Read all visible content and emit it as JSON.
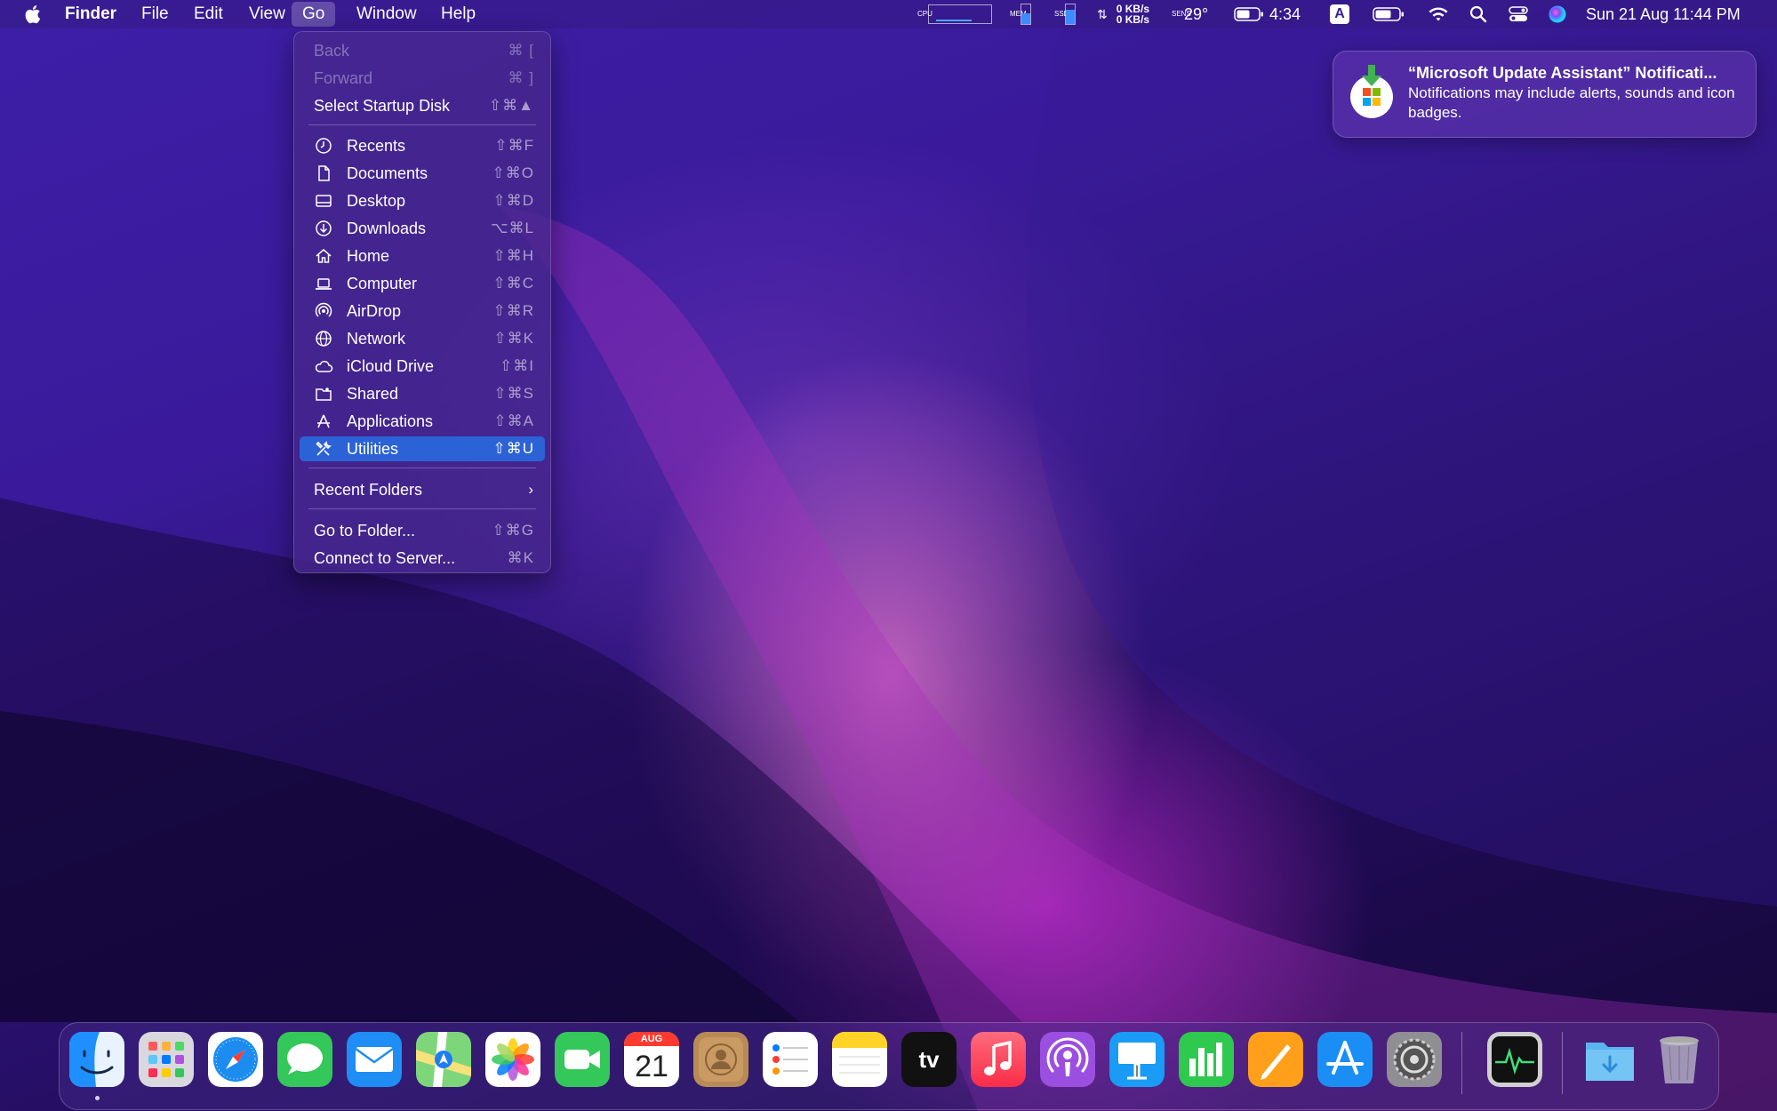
{
  "menubar": {
    "apple": "apple-logo-icon",
    "app_name": "Finder",
    "menus": [
      "File",
      "Edit",
      "View",
      "Go",
      "Window",
      "Help"
    ],
    "active_menu": "Go",
    "status": {
      "cpu_label": "CPU",
      "mem_label": "MEM",
      "ssd_label": "SSD",
      "net_up": "0 KB/s",
      "net_down": "0 KB/s",
      "sens_label": "SENS",
      "temperature": "29°",
      "battery_time": "4:34",
      "input_source": "A",
      "datetime": "Sun 21 Aug  11:44 PM"
    }
  },
  "go_menu": {
    "items": [
      {
        "label": "Back",
        "shortcut": "⌘ [",
        "disabled": true
      },
      {
        "label": "Forward",
        "shortcut": "⌘ ]",
        "disabled": true
      },
      {
        "label": "Select Startup Disk",
        "shortcut": "⇧⌘▲"
      },
      {
        "label": "Recents",
        "shortcut": "⇧⌘F",
        "icon": "clock-icon"
      },
      {
        "label": "Documents",
        "shortcut": "⇧⌘O",
        "icon": "document-icon"
      },
      {
        "label": "Desktop",
        "shortcut": "⇧⌘D",
        "icon": "desktop-icon"
      },
      {
        "label": "Downloads",
        "shortcut": "⌥⌘L",
        "icon": "download-icon"
      },
      {
        "label": "Home",
        "shortcut": "⇧⌘H",
        "icon": "home-icon"
      },
      {
        "label": "Computer",
        "shortcut": "⇧⌘C",
        "icon": "laptop-icon"
      },
      {
        "label": "AirDrop",
        "shortcut": "⇧⌘R",
        "icon": "airdrop-icon"
      },
      {
        "label": "Network",
        "shortcut": "⇧⌘K",
        "icon": "globe-icon"
      },
      {
        "label": "iCloud Drive",
        "shortcut": "⇧⌘I",
        "icon": "cloud-icon"
      },
      {
        "label": "Shared",
        "shortcut": "⇧⌘S",
        "icon": "shared-folder-icon"
      },
      {
        "label": "Applications",
        "shortcut": "⇧⌘A",
        "icon": "applications-icon"
      },
      {
        "label": "Utilities",
        "shortcut": "⇧⌘U",
        "icon": "tools-icon",
        "highlighted": true
      },
      {
        "label": "Recent Folders",
        "submenu": true
      },
      {
        "label": "Go to Folder...",
        "shortcut": "⇧⌘G"
      },
      {
        "label": "Connect to Server...",
        "shortcut": "⌘K"
      }
    ]
  },
  "notification": {
    "title": "“Microsoft Update Assistant” Notificati...",
    "body": "Notifications may include alerts, sounds and icon badges.",
    "icon": "microsoft-update-icon"
  },
  "dock": {
    "apps": [
      {
        "name": "Finder",
        "icon": "finder-icon",
        "running": true
      },
      {
        "name": "Launchpad",
        "icon": "launchpad-icon"
      },
      {
        "name": "Safari",
        "icon": "safari-icon"
      },
      {
        "name": "Messages",
        "icon": "messages-icon"
      },
      {
        "name": "Mail",
        "icon": "mail-icon"
      },
      {
        "name": "Maps",
        "icon": "maps-icon"
      },
      {
        "name": "Photos",
        "icon": "photos-icon"
      },
      {
        "name": "FaceTime",
        "icon": "facetime-icon"
      },
      {
        "name": "Calendar",
        "icon": "calendar-icon",
        "month": "AUG",
        "day": "21"
      },
      {
        "name": "Contacts",
        "icon": "contacts-icon"
      },
      {
        "name": "Reminders",
        "icon": "reminders-icon"
      },
      {
        "name": "Notes",
        "icon": "notes-icon"
      },
      {
        "name": "TV",
        "icon": "apple-tv-icon",
        "text": "tv"
      },
      {
        "name": "Music",
        "icon": "music-icon"
      },
      {
        "name": "Podcasts",
        "icon": "podcasts-icon"
      },
      {
        "name": "Keynote",
        "icon": "keynote-icon"
      },
      {
        "name": "Numbers",
        "icon": "numbers-icon"
      },
      {
        "name": "Pages",
        "icon": "pages-icon"
      },
      {
        "name": "App Store",
        "icon": "app-store-icon"
      },
      {
        "name": "System Preferences",
        "icon": "system-preferences-icon"
      },
      {
        "name": "Activity Monitor",
        "icon": "activity-monitor-icon"
      },
      {
        "name": "Downloads",
        "icon": "downloads-folder-icon"
      },
      {
        "name": "Trash",
        "icon": "trash-icon"
      }
    ]
  },
  "colors": {
    "menu_highlight": "#2b62d6",
    "wallpaper_base": "#2a1170"
  }
}
